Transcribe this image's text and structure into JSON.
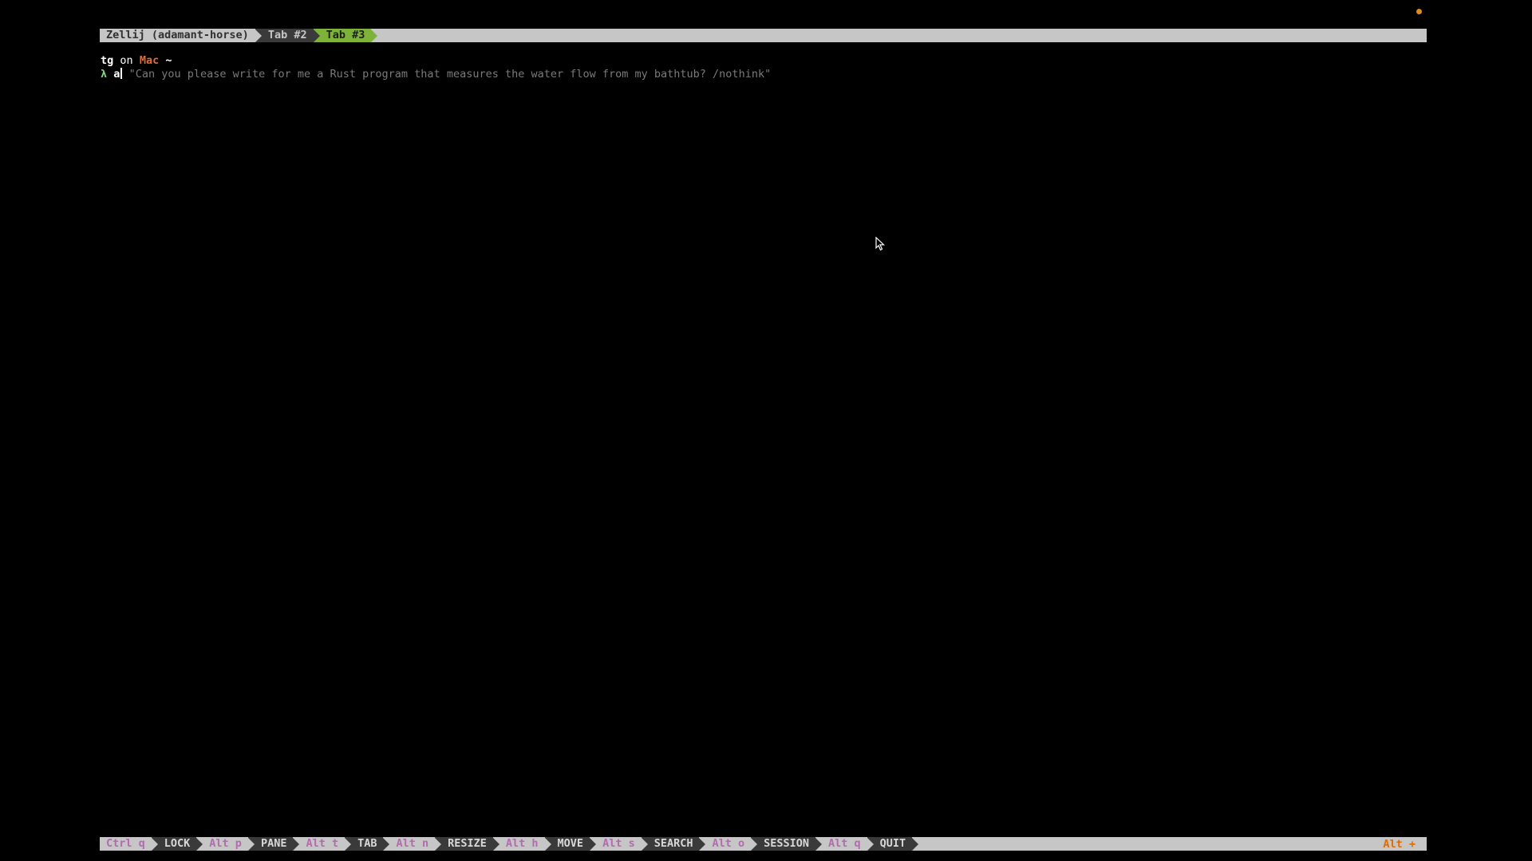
{
  "top_bar": {
    "session": "Zellij (adamant-horse)",
    "tabs": [
      {
        "label": "Tab #2",
        "active": false
      },
      {
        "label": "Tab #3",
        "active": true
      }
    ]
  },
  "terminal": {
    "user": "tg",
    "on": "on",
    "host": "Mac",
    "dir": "~",
    "prompt_symbol": "λ",
    "command": "a",
    "suggestion": "\"Can you please write for me a Rust program that measures the water flow from my bathtub? /nothink\""
  },
  "bottom_bar": {
    "items": [
      {
        "key": "Ctrl q",
        "mode": "LOCK"
      },
      {
        "key": "Alt p",
        "mode": "PANE"
      },
      {
        "key": "Alt t",
        "mode": "TAB"
      },
      {
        "key": "Alt n",
        "mode": "RESIZE"
      },
      {
        "key": "Alt h",
        "mode": "MOVE"
      },
      {
        "key": "Alt s",
        "mode": "SEARCH"
      },
      {
        "key": "Alt o",
        "mode": "SESSION"
      },
      {
        "key": "Alt q",
        "mode": "QUIT"
      }
    ],
    "right_hint": "Alt +"
  },
  "colors": {
    "background": "#000000",
    "bar_grey": "#c6c6c6",
    "tab_dark": "#3a3a3a",
    "tab_active": "#7eb33a",
    "key_magenta": "#b36ab0",
    "host_orange": "#e06c3a",
    "lambda_green": "#7ed67e",
    "indicator_dot": "#e08a1e"
  }
}
